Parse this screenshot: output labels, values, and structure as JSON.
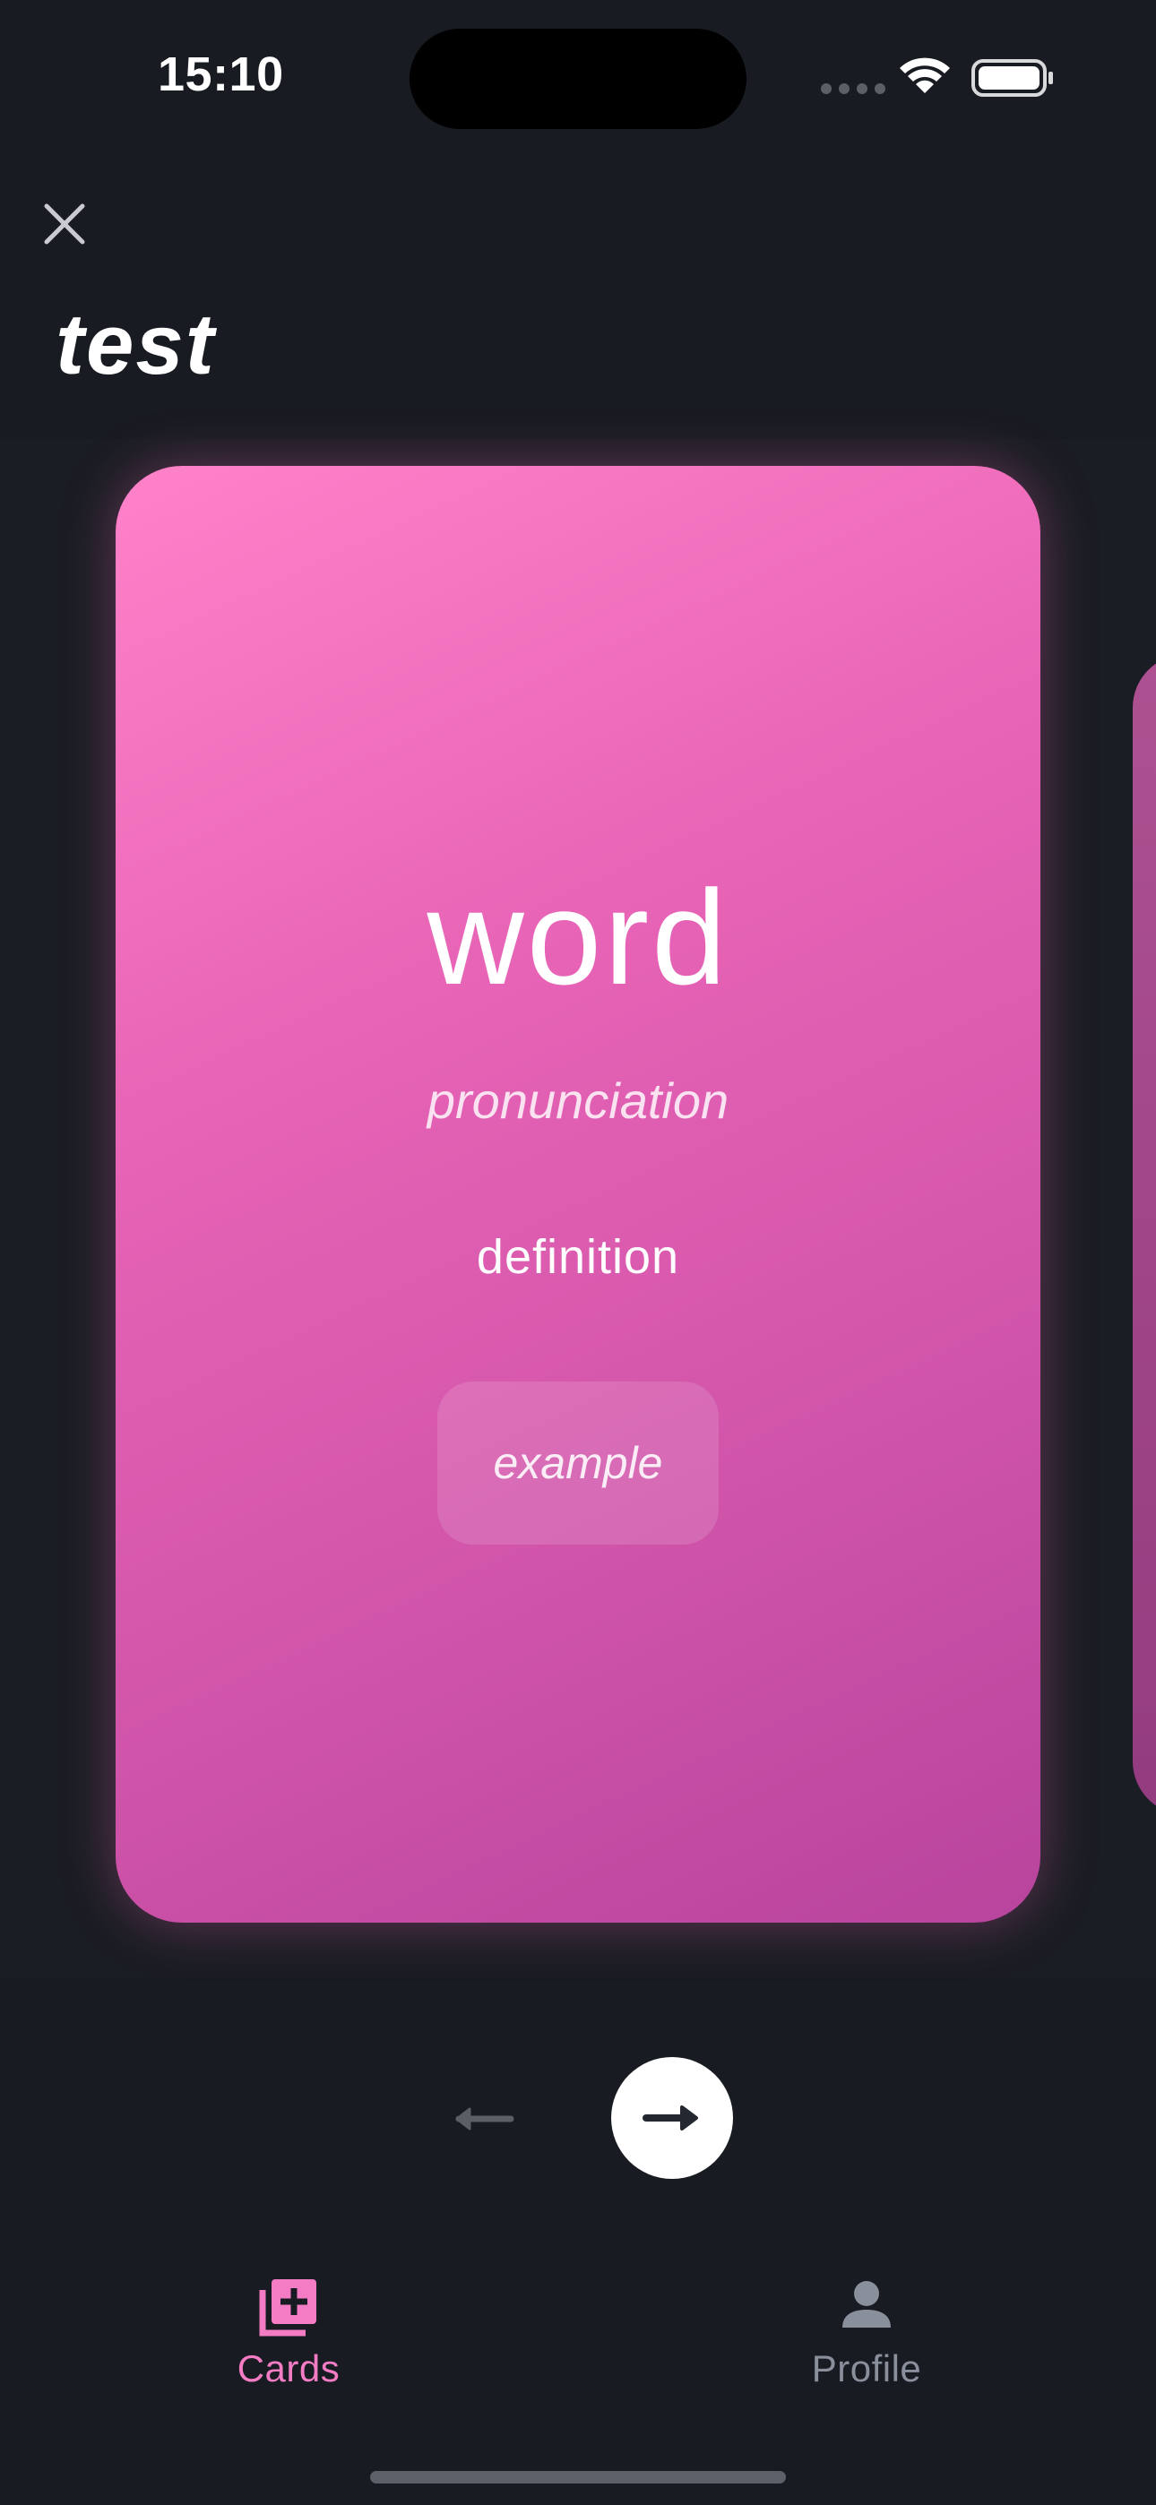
{
  "status_bar": {
    "time": "15:10",
    "signal_icon": "cellular-dots-icon",
    "wifi_icon": "wifi-icon",
    "battery_icon": "battery-full-icon"
  },
  "header": {
    "close_icon": "close-icon",
    "deck_title": "test"
  },
  "card": {
    "word": "word",
    "pronunciation": "pronunciation",
    "definition": "definition",
    "example": "example",
    "gradient_colors": [
      "#ff82c9",
      "#b8449d"
    ]
  },
  "navigation": {
    "prev_icon": "arrow-left-icon",
    "next_icon": "arrow-right-icon"
  },
  "tab_bar": {
    "tabs": [
      {
        "label": "Cards",
        "icon": "add-cards-icon",
        "active": true
      },
      {
        "label": "Profile",
        "icon": "person-icon",
        "active": false
      }
    ],
    "active_color": "#f37cc4",
    "inactive_color": "#8a8f9c"
  }
}
